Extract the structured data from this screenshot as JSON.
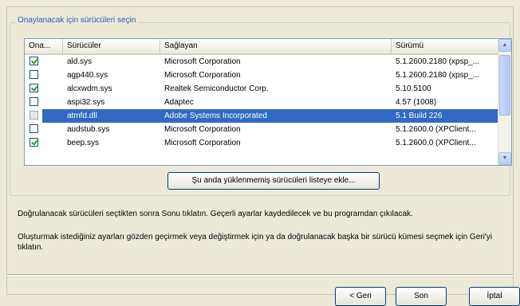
{
  "group": {
    "title": "Onaylanacak için sürücüleri seçin"
  },
  "listview": {
    "columns": [
      "Ona...",
      "Sürücüler",
      "Sağlayan",
      "Sürümü"
    ],
    "rows": [
      {
        "checked": true,
        "driver": "ald.sys",
        "provider": "Microsoft Corporation",
        "version": "5.1.2600.2180 (xpsp_..."
      },
      {
        "checked": false,
        "driver": "agp440.sys",
        "provider": "Microsoft Corporation",
        "version": "5.1.2600.2180 (xpsp_..."
      },
      {
        "checked": true,
        "driver": "alcxwdm.sys",
        "provider": "Realtek Semiconductor Corp.",
        "version": "5.10.5100"
      },
      {
        "checked": false,
        "driver": "aspi32.sys",
        "provider": "Adaptec",
        "version": "4.57 (1008)"
      },
      {
        "checked": false,
        "driver": "atmfd.dll",
        "provider": "Adobe Systems Incorporated",
        "version": "5.1 Build 226"
      },
      {
        "checked": false,
        "driver": "audstub.sys",
        "provider": "Microsoft Corporation",
        "version": "5.1.2600.0 (XPClient..."
      },
      {
        "checked": true,
        "driver": "beep.sys",
        "provider": "Microsoft Corporation",
        "version": "5.1.2600.0 (XPClient..."
      }
    ],
    "selected_index": 4
  },
  "add_button": {
    "label": "Şu anda yüklenmemiş sürücüleri listeye ekle..."
  },
  "info": {
    "line1": "Doğrulanacak sürücüleri seçtikten sonra Sonu tıklatın. Geçerli ayarlar kaydedilecek ve bu programdan çıkılacak.",
    "line2": "Oluşturmak istediğiniz ayarları gözden geçirmek veya değiştirmek için ya da doğrulanacak başka bir sürücü kümesi seçmek için Geri'yi tıklatın."
  },
  "buttons": {
    "back": "< Geri",
    "finish": "Son",
    "cancel": "İptal"
  }
}
